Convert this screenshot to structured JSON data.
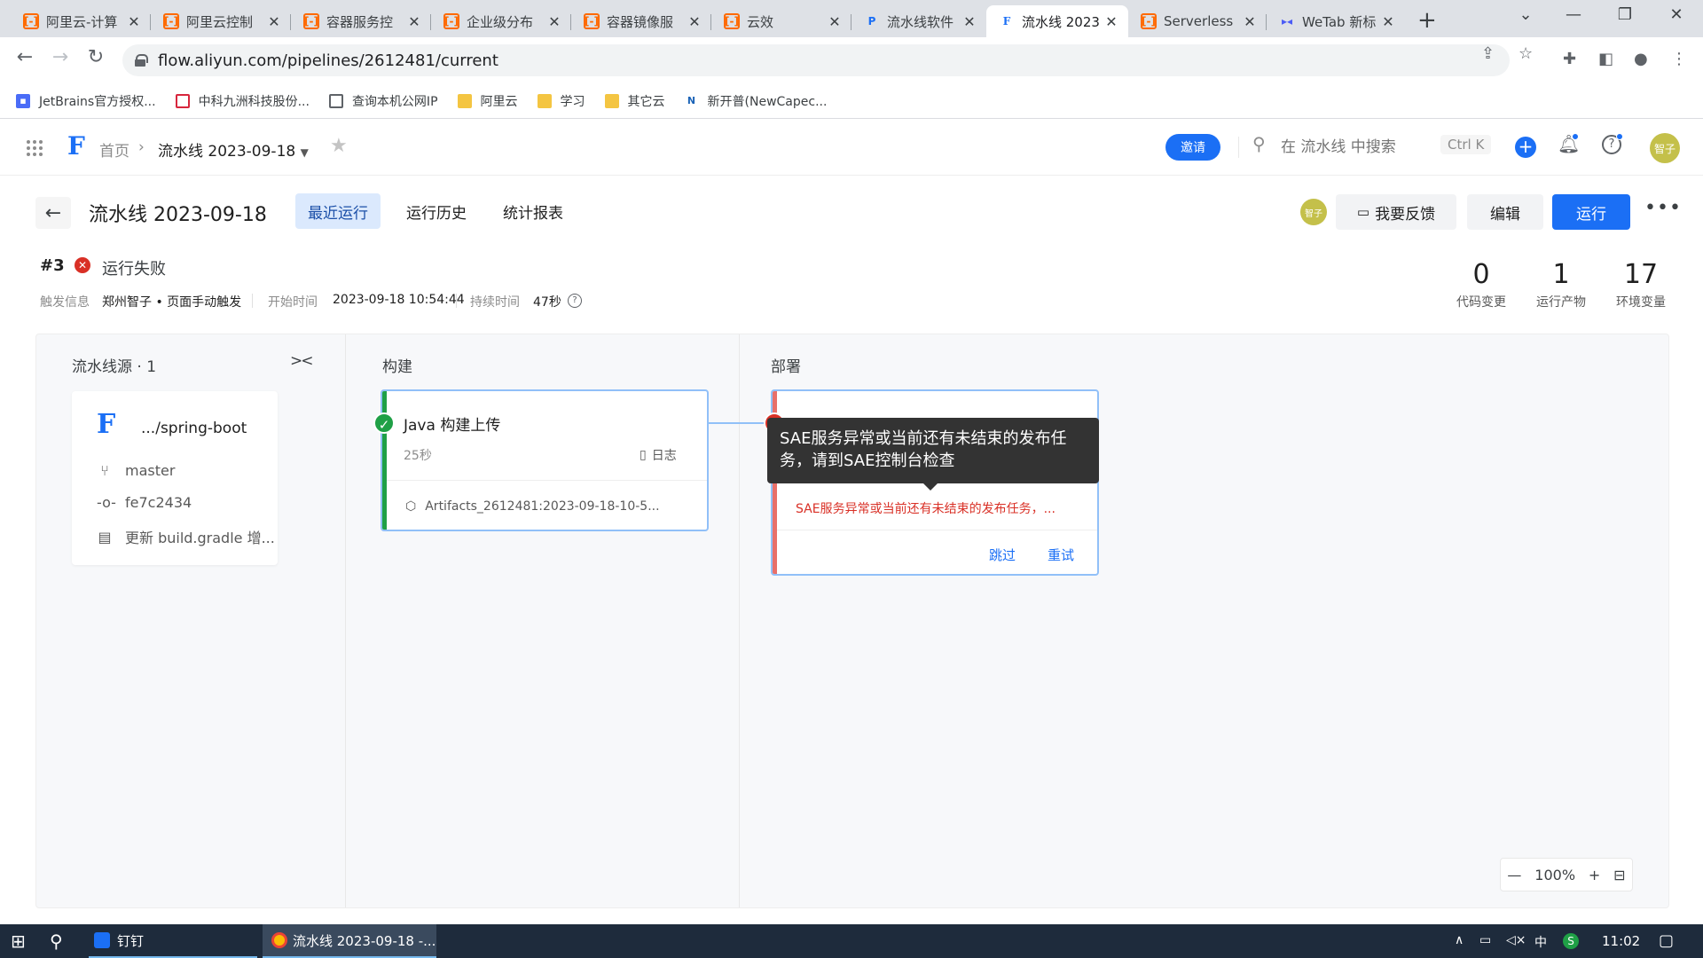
{
  "browser": {
    "tabs": [
      {
        "title": "阿里云-计算",
        "icon": "aliyun-icon"
      },
      {
        "title": "阿里云控制",
        "icon": "aliyun-icon"
      },
      {
        "title": "容器服务控",
        "icon": "aliyun-icon"
      },
      {
        "title": "企业级分布",
        "icon": "aliyun-icon"
      },
      {
        "title": "容器镜像服",
        "icon": "aliyun-icon"
      },
      {
        "title": "云效",
        "icon": "aliyun-icon"
      },
      {
        "title": "流水线软件",
        "icon": "p-icon"
      },
      {
        "title": "流水线 2023",
        "icon": "flow-icon"
      },
      {
        "title": "Serverless",
        "icon": "aliyun-icon"
      },
      {
        "title": "WeTab 新标",
        "icon": "wetab-icon"
      }
    ],
    "active_tab_index": 7,
    "url": "flow.aliyun.com/pipelines/2612481/current",
    "bookmarks": [
      {
        "label": "JetBrains官方授权...",
        "icon": "jetbrains-icon"
      },
      {
        "label": "中科九洲科技股份...",
        "icon": "zhongke-icon"
      },
      {
        "label": "查询本机公网IP",
        "icon": "globe-icon"
      },
      {
        "label": "阿里云",
        "icon": "folder-icon"
      },
      {
        "label": "学习",
        "icon": "folder-icon"
      },
      {
        "label": "其它云",
        "icon": "folder-icon"
      },
      {
        "label": "新开普(NewCapec...",
        "icon": "newcapec-icon"
      }
    ]
  },
  "header": {
    "breadcrumb_home": "首页",
    "breadcrumb_current": "流水线 2023-09-18",
    "invite_label": "邀请",
    "search_placeholder": "在 流水线 中搜索",
    "search_shortcut": "Ctrl K",
    "user_avatar": "智子"
  },
  "pipeline": {
    "title": "流水线 2023-09-18",
    "tabs": [
      "最近运行",
      "运行历史",
      "统计报表"
    ],
    "active_tab": 0,
    "viewer_avatar": "智子",
    "feedback_label": "我要反馈",
    "edit_label": "编辑",
    "run_label": "运行",
    "run_number": "#3",
    "run_status": "运行失败",
    "trigger_label": "触发信息",
    "trigger_value": "郑州智子 • 页面手动触发",
    "start_label": "开始时间",
    "start_value": "2023-09-18 10:54:44",
    "duration_label": "持续时间",
    "duration_value": "47秒",
    "stats": [
      {
        "value": "0",
        "label": "代码变更"
      },
      {
        "value": "1",
        "label": "运行产物"
      },
      {
        "value": "17",
        "label": "环境变量"
      }
    ]
  },
  "canvas": {
    "source_title": "流水线源 · 1",
    "source": {
      "repo": ".../spring-boot",
      "branch": "master",
      "commit": "fe7c2434",
      "message": "更新 build.gradle 增..."
    },
    "stages": [
      {
        "title": "构建",
        "job": {
          "name": "Java 构建上传",
          "duration": "25秒",
          "log_label": "日志",
          "artifact": "Artifacts_2612481:2023-09-18-10-5...",
          "status": "success"
        }
      },
      {
        "title": "部署",
        "job": {
          "error": "SAE服务异常或当前还有未结束的发布任务，...",
          "skip_label": "跳过",
          "retry_label": "重试",
          "status": "failed"
        }
      }
    ],
    "tooltip": "SAE服务异常或当前还有未结束的发布任务，请到SAE控制台检查",
    "zoom": "100%"
  },
  "taskbar": {
    "apps": [
      {
        "label": "钉钉"
      },
      {
        "label": "流水线 2023-09-18 -..."
      }
    ],
    "ime": "中",
    "clock": "11:02"
  },
  "colors": {
    "primary": "#1b6ff5",
    "error": "#d93026",
    "success": "#1fa046",
    "aliyun": "#ff6a00"
  }
}
